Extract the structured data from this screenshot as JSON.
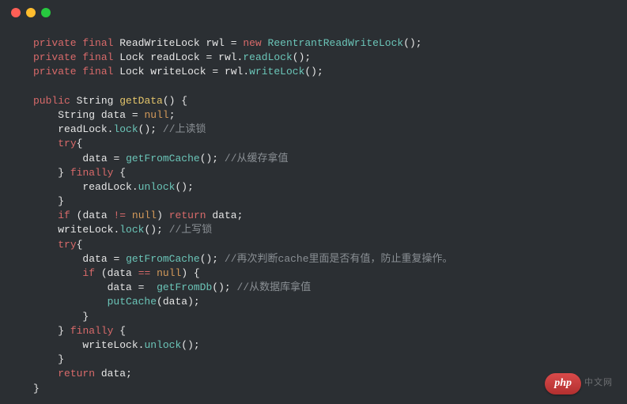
{
  "window": {
    "controls": [
      "close",
      "minimize",
      "zoom"
    ]
  },
  "code": {
    "lines": [
      {
        "indent": 0,
        "t": [
          [
            "kw",
            "private"
          ],
          [
            "sp",
            " "
          ],
          [
            "kw",
            "final"
          ],
          [
            "sp",
            " "
          ],
          [
            "type",
            "ReadWriteLock"
          ],
          [
            "sp",
            " "
          ],
          [
            "ident",
            "rwl"
          ],
          [
            "sp",
            " "
          ],
          [
            "punct",
            "="
          ],
          [
            "sp",
            " "
          ],
          [
            "kw",
            "new"
          ],
          [
            "sp",
            " "
          ],
          [
            "call",
            "ReentrantReadWriteLock"
          ],
          [
            "punct",
            "();"
          ]
        ]
      },
      {
        "indent": 0,
        "t": [
          [
            "kw",
            "private"
          ],
          [
            "sp",
            " "
          ],
          [
            "kw",
            "final"
          ],
          [
            "sp",
            " "
          ],
          [
            "type",
            "Lock"
          ],
          [
            "sp",
            " "
          ],
          [
            "ident",
            "readLock"
          ],
          [
            "sp",
            " "
          ],
          [
            "punct",
            "="
          ],
          [
            "sp",
            " "
          ],
          [
            "ident",
            "rwl"
          ],
          [
            "punct",
            "."
          ],
          [
            "call",
            "readLock"
          ],
          [
            "punct",
            "();"
          ]
        ]
      },
      {
        "indent": 0,
        "t": [
          [
            "kw",
            "private"
          ],
          [
            "sp",
            " "
          ],
          [
            "kw",
            "final"
          ],
          [
            "sp",
            " "
          ],
          [
            "type",
            "Lock"
          ],
          [
            "sp",
            " "
          ],
          [
            "ident",
            "writeLock"
          ],
          [
            "sp",
            " "
          ],
          [
            "punct",
            "="
          ],
          [
            "sp",
            " "
          ],
          [
            "ident",
            "rwl"
          ],
          [
            "punct",
            "."
          ],
          [
            "call",
            "writeLock"
          ],
          [
            "punct",
            "();"
          ]
        ]
      },
      {
        "indent": 0,
        "t": []
      },
      {
        "indent": 0,
        "t": [
          [
            "kw",
            "public"
          ],
          [
            "sp",
            " "
          ],
          [
            "type",
            "String"
          ],
          [
            "sp",
            " "
          ],
          [
            "method",
            "getData"
          ],
          [
            "punct",
            "() {"
          ]
        ]
      },
      {
        "indent": 1,
        "t": [
          [
            "type",
            "String"
          ],
          [
            "sp",
            " "
          ],
          [
            "ident",
            "data"
          ],
          [
            "sp",
            " "
          ],
          [
            "punct",
            "="
          ],
          [
            "sp",
            " "
          ],
          [
            "null",
            "null"
          ],
          [
            "punct",
            ";"
          ]
        ]
      },
      {
        "indent": 1,
        "t": [
          [
            "ident",
            "readLock"
          ],
          [
            "punct",
            "."
          ],
          [
            "call",
            "lock"
          ],
          [
            "punct",
            "();"
          ],
          [
            "sp",
            " "
          ],
          [
            "comment",
            "//上读锁"
          ]
        ]
      },
      {
        "indent": 1,
        "t": [
          [
            "kw",
            "try"
          ],
          [
            "punct",
            "{"
          ]
        ]
      },
      {
        "indent": 2,
        "t": [
          [
            "ident",
            "data"
          ],
          [
            "sp",
            " "
          ],
          [
            "punct",
            "="
          ],
          [
            "sp",
            " "
          ],
          [
            "call",
            "getFromCache"
          ],
          [
            "punct",
            "();"
          ],
          [
            "sp",
            " "
          ],
          [
            "comment",
            "//从缓存拿值"
          ]
        ]
      },
      {
        "indent": 1,
        "t": [
          [
            "punct",
            "}"
          ],
          [
            "sp",
            " "
          ],
          [
            "kw",
            "finally"
          ],
          [
            "sp",
            " "
          ],
          [
            "punct",
            "{"
          ]
        ]
      },
      {
        "indent": 2,
        "t": [
          [
            "ident",
            "readLock"
          ],
          [
            "punct",
            "."
          ],
          [
            "call",
            "unlock"
          ],
          [
            "punct",
            "();"
          ]
        ]
      },
      {
        "indent": 1,
        "t": [
          [
            "punct",
            "}"
          ]
        ]
      },
      {
        "indent": 1,
        "t": [
          [
            "kw",
            "if"
          ],
          [
            "sp",
            " "
          ],
          [
            "punct",
            "("
          ],
          [
            "ident",
            "data"
          ],
          [
            "sp",
            " "
          ],
          [
            "op",
            "!="
          ],
          [
            "sp",
            " "
          ],
          [
            "null",
            "null"
          ],
          [
            "punct",
            ")"
          ],
          [
            "sp",
            " "
          ],
          [
            "kw",
            "return"
          ],
          [
            "sp",
            " "
          ],
          [
            "ident",
            "data"
          ],
          [
            "punct",
            ";"
          ]
        ]
      },
      {
        "indent": 1,
        "t": [
          [
            "ident",
            "writeLock"
          ],
          [
            "punct",
            "."
          ],
          [
            "call",
            "lock"
          ],
          [
            "punct",
            "();"
          ],
          [
            "sp",
            " "
          ],
          [
            "comment",
            "//上写锁"
          ]
        ]
      },
      {
        "indent": 1,
        "t": [
          [
            "kw",
            "try"
          ],
          [
            "punct",
            "{"
          ]
        ]
      },
      {
        "indent": 2,
        "t": [
          [
            "ident",
            "data"
          ],
          [
            "sp",
            " "
          ],
          [
            "punct",
            "="
          ],
          [
            "sp",
            " "
          ],
          [
            "call",
            "getFromCache"
          ],
          [
            "punct",
            "();"
          ],
          [
            "sp",
            " "
          ],
          [
            "comment",
            "//再次判断cache里面是否有值，防止重复操作。"
          ]
        ]
      },
      {
        "indent": 2,
        "t": [
          [
            "kw",
            "if"
          ],
          [
            "sp",
            " "
          ],
          [
            "punct",
            "("
          ],
          [
            "ident",
            "data"
          ],
          [
            "sp",
            " "
          ],
          [
            "op",
            "=="
          ],
          [
            "sp",
            " "
          ],
          [
            "null",
            "null"
          ],
          [
            "punct",
            ") {"
          ]
        ]
      },
      {
        "indent": 3,
        "t": [
          [
            "ident",
            "data"
          ],
          [
            "sp",
            " "
          ],
          [
            "punct",
            "="
          ],
          [
            "sp",
            "  "
          ],
          [
            "call",
            "getFromDb"
          ],
          [
            "punct",
            "();"
          ],
          [
            "sp",
            " "
          ],
          [
            "comment",
            "//从数据库拿值"
          ]
        ]
      },
      {
        "indent": 3,
        "t": [
          [
            "call",
            "putCache"
          ],
          [
            "punct",
            "("
          ],
          [
            "ident",
            "data"
          ],
          [
            "punct",
            ");"
          ]
        ]
      },
      {
        "indent": 2,
        "t": [
          [
            "punct",
            "}"
          ]
        ]
      },
      {
        "indent": 1,
        "t": [
          [
            "punct",
            "}"
          ],
          [
            "sp",
            " "
          ],
          [
            "kw",
            "finally"
          ],
          [
            "sp",
            " "
          ],
          [
            "punct",
            "{"
          ]
        ]
      },
      {
        "indent": 2,
        "t": [
          [
            "ident",
            "writeLock"
          ],
          [
            "punct",
            "."
          ],
          [
            "call",
            "unlock"
          ],
          [
            "punct",
            "();"
          ]
        ]
      },
      {
        "indent": 1,
        "t": [
          [
            "punct",
            "}"
          ]
        ]
      },
      {
        "indent": 1,
        "t": [
          [
            "kw",
            "return"
          ],
          [
            "sp",
            " "
          ],
          [
            "ident",
            "data"
          ],
          [
            "punct",
            ";"
          ]
        ]
      },
      {
        "indent": 0,
        "t": [
          [
            "punct",
            "}"
          ]
        ]
      }
    ]
  },
  "watermark": {
    "pill": "php",
    "suffix": "中文网"
  }
}
